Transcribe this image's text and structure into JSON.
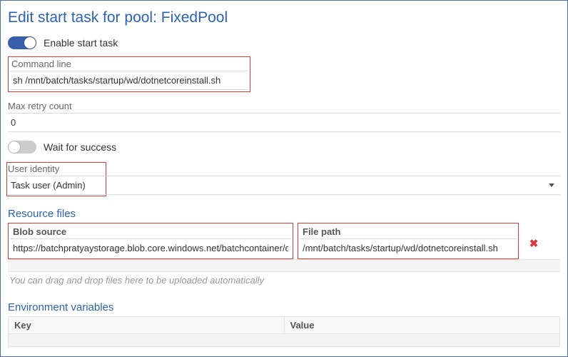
{
  "title": "Edit start task for pool: FixedPool",
  "toggles": {
    "enable_label": "Enable start task",
    "wait_label": "Wait for success"
  },
  "fields": {
    "command_line_label": "Command line",
    "command_line_value": "sh /mnt/batch/tasks/startup/wd/dotnetcoreinstall.sh",
    "max_retry_label": "Max retry count",
    "max_retry_value": "0",
    "user_identity_label": "User identity",
    "user_identity_value": "Task user (Admin)"
  },
  "resource": {
    "section_title": "Resource files",
    "blob_header": "Blob source",
    "blob_value": "https://batchpratyaystorage.blob.core.windows.net/batchcontainer/dot",
    "path_header": "File path",
    "path_value": "/mnt/batch/tasks/startup/wd/dotnetcoreinstall.sh",
    "drop_hint": "You can drag and drop files here to be uploaded automatically"
  },
  "env": {
    "section_title": "Environment variables",
    "key_header": "Key",
    "value_header": "Value"
  }
}
